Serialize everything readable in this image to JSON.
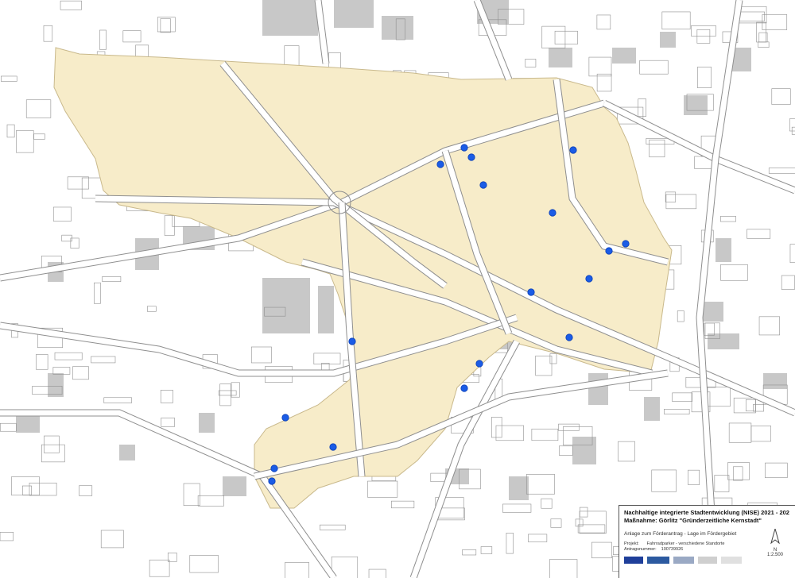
{
  "map": {
    "colors": {
      "background": "#ffffff",
      "project_area": "#f7ecc9",
      "project_area_edge": "#c9b98c",
      "building": "#c8c8c8",
      "block_line": "#8f8f8f",
      "street": "#ffffff",
      "marker": "#1b5ce6",
      "marker_edge": "#0b3fb6"
    },
    "marker_count": 21
  },
  "legend": {
    "title": "Nachhaltige integrierte Stadtentwicklung (NISE) 2021 - 202",
    "measure": "Maßnahme: Görlitz \"Gründerzeitliche Kernstadt\"",
    "annex": "Anlage zum Förderantrag - Lage im Fördergebiet",
    "project_label": "Projekt:",
    "project_value": "Fahrradparker - verschiedene Standorte",
    "application_label": "Antragsnummer:",
    "application_value": "100739926",
    "scale": "1:2.500",
    "north_symbol": "N"
  }
}
